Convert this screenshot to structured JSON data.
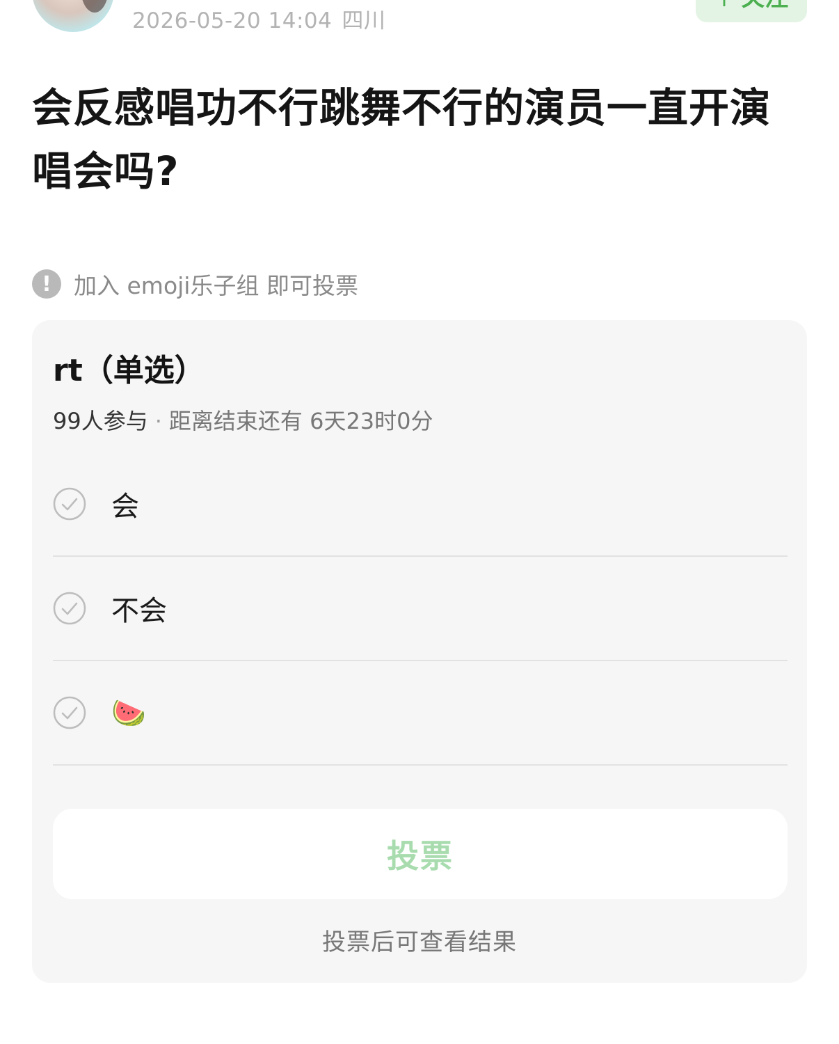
{
  "header": {
    "timestamp": "2026-05-20 14:04",
    "location": "四川",
    "follow_label": "关注",
    "follow_prefix": "+"
  },
  "post": {
    "title": "会反感唱功不行跳舞不行的演员一直开演唱会吗?"
  },
  "notice": {
    "icon": "exclamation-icon",
    "text": "加入 emoji乐子组 即可投票"
  },
  "poll": {
    "title": "rt（单选）",
    "participants": "99人参与",
    "separator": "·",
    "time_remaining": "距离结束还有 6天23时0分",
    "options": [
      {
        "label": "会",
        "icon": "check-circle-icon"
      },
      {
        "label": "不会",
        "icon": "check-circle-icon"
      },
      {
        "label": "🍉",
        "icon": "check-circle-icon"
      }
    ],
    "vote_label": "投票",
    "result_hint": "投票后可查看结果"
  },
  "colors": {
    "accent_green": "#4caf50",
    "vote_text_disabled": "#a8dcae",
    "card_background": "#f6f6f6",
    "meta_gray": "#b3b3b3"
  }
}
